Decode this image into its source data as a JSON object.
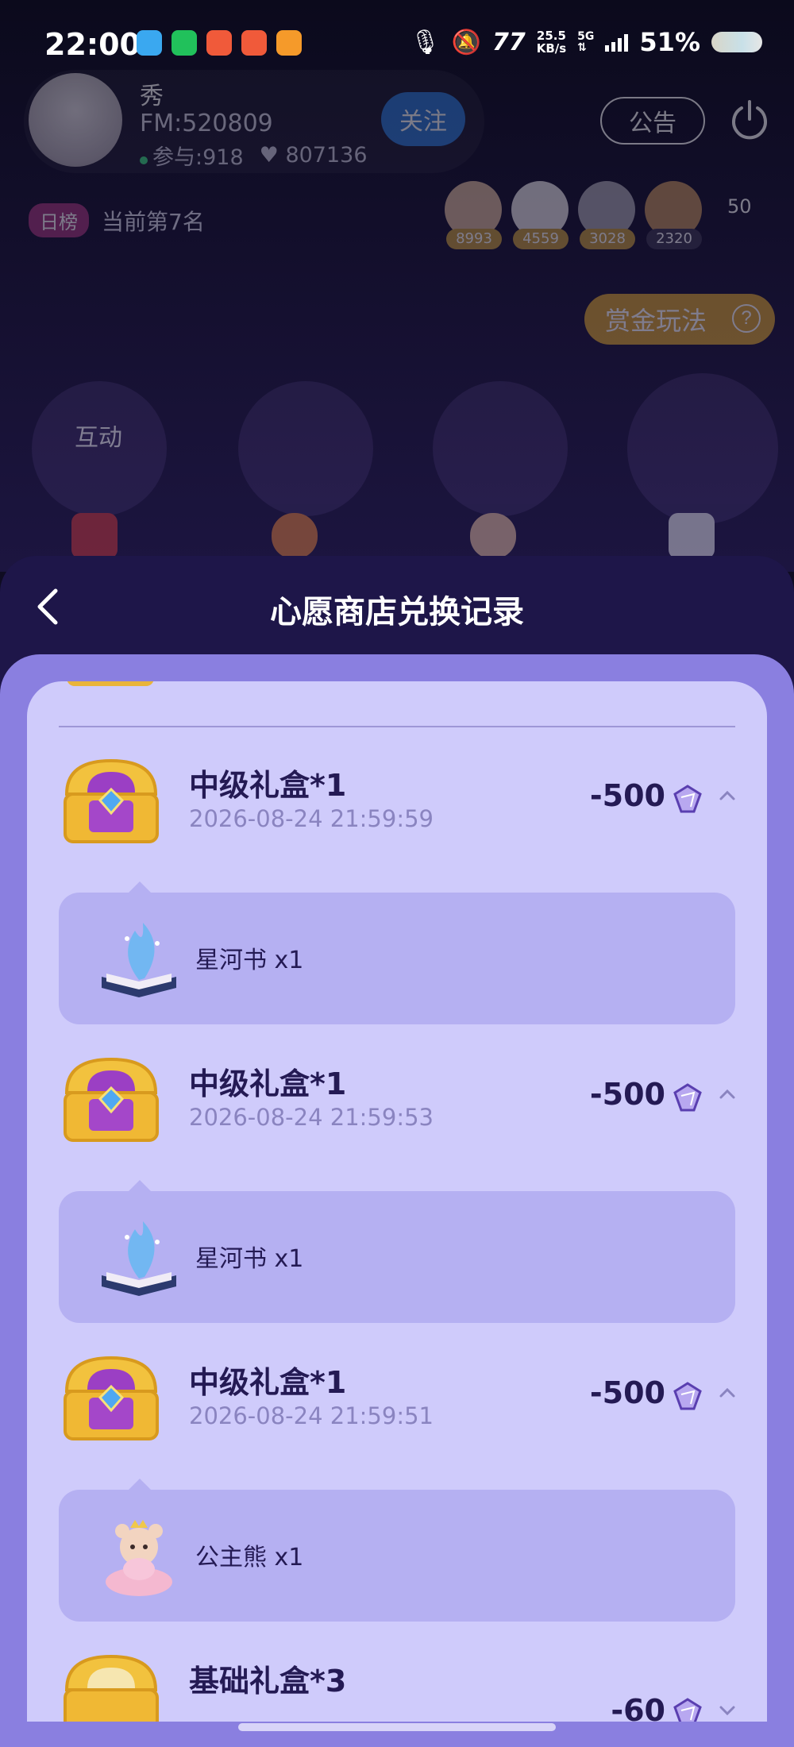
{
  "status_bar": {
    "time": "22:00",
    "net_speed_value": "25.5",
    "net_speed_unit": "KB/s",
    "network": "5G",
    "battery": "51%"
  },
  "room": {
    "host_name": "秀",
    "fm_id": "FM:520809",
    "participants": "参与:918",
    "likes": "807136",
    "follow_label": "关注",
    "notice_label": "公告",
    "rank_badge": "日榜",
    "rank_text": "当前第7名",
    "viewers": [
      {
        "score": "8993"
      },
      {
        "score": "4559"
      },
      {
        "score": "3028"
      },
      {
        "score": "2320"
      }
    ],
    "viewer_count": "50",
    "bounty_label": "赏金玩法",
    "interact_label": "互动"
  },
  "sheet": {
    "title": "心愿商店兑换记录"
  },
  "records": [
    {
      "title": "中级礼盒*1",
      "time": "2026-08-24 21:59:59",
      "amount": "-500",
      "item": "星河书 x1",
      "item_icon": "star-river-book-icon",
      "expanded": true
    },
    {
      "title": "中级礼盒*1",
      "time": "2026-08-24 21:59:53",
      "amount": "-500",
      "item": "星河书 x1",
      "item_icon": "star-river-book-icon",
      "expanded": true
    },
    {
      "title": "中级礼盒*1",
      "time": "2026-08-24 21:59:51",
      "amount": "-500",
      "item": "公主熊 x1",
      "item_icon": "princess-bear-icon",
      "expanded": true
    },
    {
      "title": "基础礼盒*3",
      "time": "",
      "amount": "-60",
      "expanded": false
    }
  ],
  "colors": {
    "sheet_bg": "#1e1649",
    "panel_outer": "#8a7fe0",
    "panel_inner": "#cfcbfb",
    "detail_bg": "#b5b0f2",
    "text_primary": "#241a54",
    "text_secondary": "#8a84c0"
  }
}
